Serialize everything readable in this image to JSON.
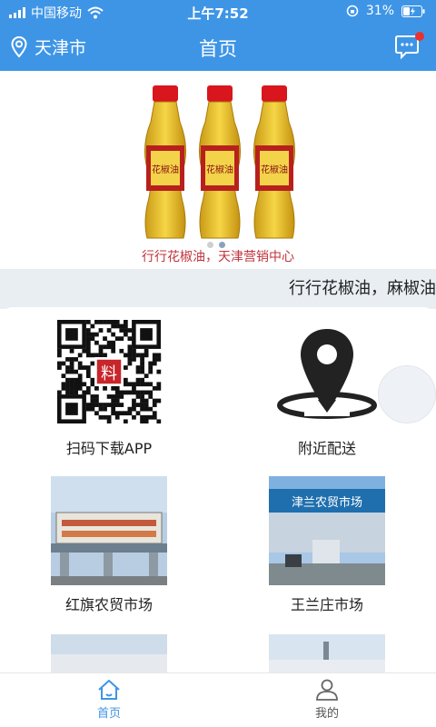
{
  "status_bar": {
    "carrier": "中国移动",
    "time": "上午7:52",
    "battery": "31%",
    "icons": [
      "signal-icon",
      "wifi-icon",
      "rotation-lock-icon",
      "battery-icon"
    ]
  },
  "header": {
    "location": "天津市",
    "title": "首页",
    "icons": [
      "location-pin-icon",
      "message-icon"
    ]
  },
  "banner": {
    "caption": "行行花椒油，天津营销中心",
    "bottle_label": "花椒油",
    "page_count": 2,
    "active_page": 2
  },
  "marquee": {
    "text": "行行花椒油，麻椒油"
  },
  "tiles": [
    {
      "label": "扫码下载APP",
      "icon": "qr-code-icon",
      "qr_center_char": "料"
    },
    {
      "label": "附近配送",
      "icon": "map-pin-icon"
    },
    {
      "label": "红旗农贸市场",
      "icon": "market-photo"
    },
    {
      "label": "王兰庄市场",
      "icon": "market-photo",
      "sign_text": "津兰农贸市场"
    }
  ],
  "tabbar": {
    "items": [
      {
        "label": "首页",
        "icon": "home-icon",
        "active": true
      },
      {
        "label": "我的",
        "icon": "user-icon",
        "active": false
      }
    ]
  },
  "colors": {
    "primary": "#3e95e6",
    "marquee_bg": "#e9eef3",
    "caption": "#c0343c",
    "badge": "#e8322f"
  }
}
